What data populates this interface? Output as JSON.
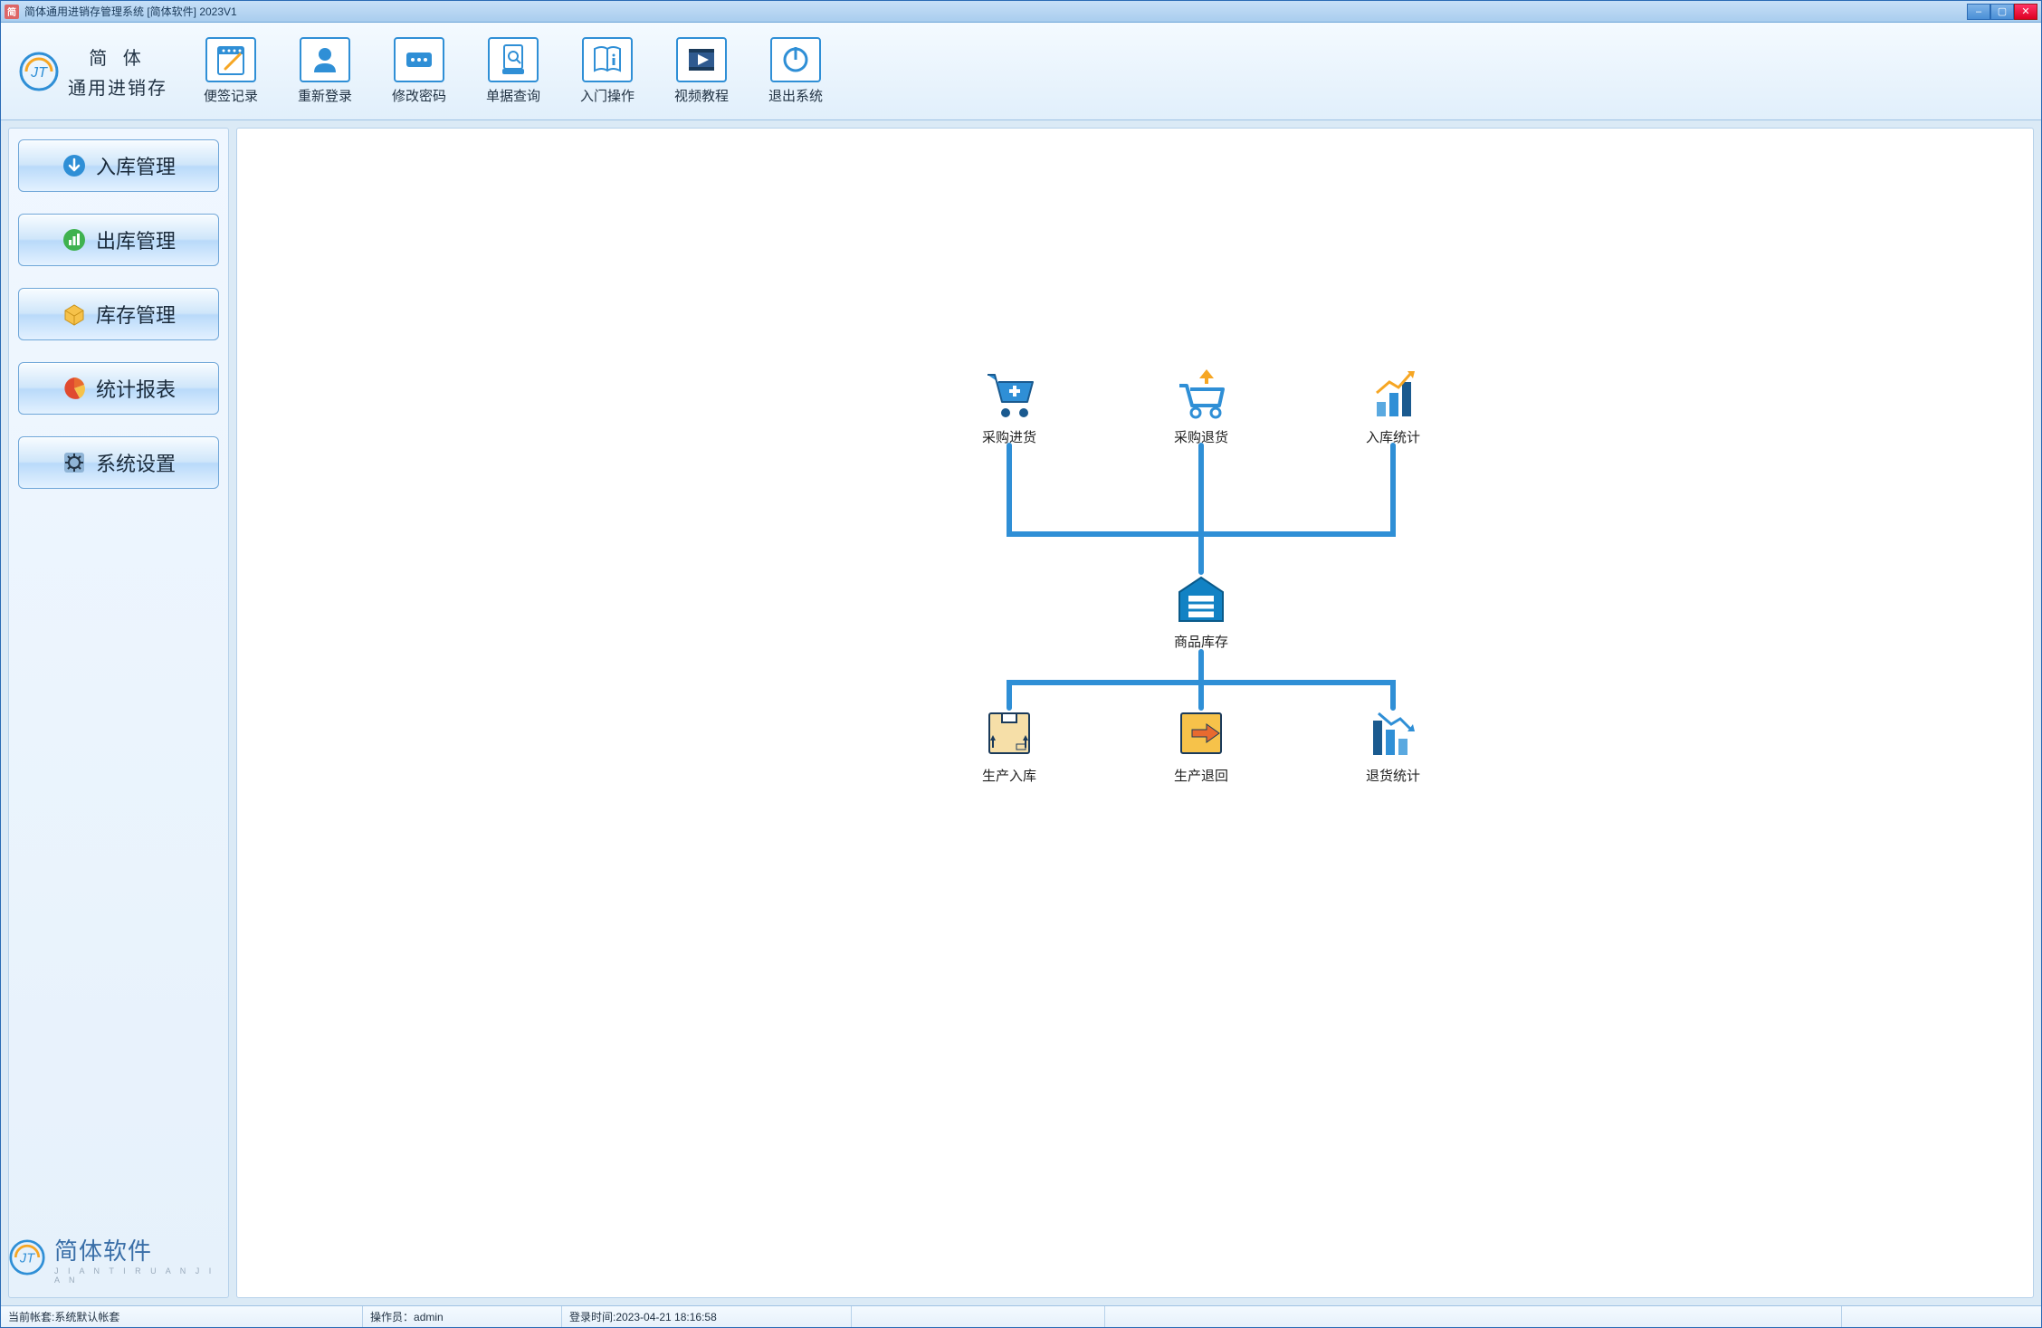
{
  "window": {
    "title": "简体通用进销存管理系统 [简体软件] 2023V1"
  },
  "brand": {
    "line1": "简 体",
    "line2": "通用进销存"
  },
  "toolbar": [
    {
      "id": "notes",
      "label": "便签记录"
    },
    {
      "id": "relogin",
      "label": "重新登录"
    },
    {
      "id": "password",
      "label": "修改密码"
    },
    {
      "id": "billquery",
      "label": "单据查询"
    },
    {
      "id": "guide",
      "label": "入门操作"
    },
    {
      "id": "video",
      "label": "视频教程"
    },
    {
      "id": "exit",
      "label": "退出系统"
    }
  ],
  "sidebar": [
    {
      "id": "inbound",
      "label": "入库管理"
    },
    {
      "id": "outbound",
      "label": "出库管理"
    },
    {
      "id": "inventory",
      "label": "库存管理"
    },
    {
      "id": "report",
      "label": "统计报表"
    },
    {
      "id": "settings",
      "label": "系统设置"
    }
  ],
  "footer_brand": {
    "text": "简体软件",
    "pinyin": "J I A N T I R U A N J I A N"
  },
  "flow": {
    "top": [
      {
        "label": "采购进货"
      },
      {
        "label": "采购退货"
      },
      {
        "label": "入库统计"
      }
    ],
    "center": {
      "label": "商品库存"
    },
    "bottom": [
      {
        "label": "生产入库"
      },
      {
        "label": "生产退回"
      },
      {
        "label": "退货统计"
      }
    ]
  },
  "status": {
    "account_label": "当前帐套:",
    "account_value": "系统默认帐套",
    "operator_label": "操作员：",
    "operator_value": "admin",
    "login_label": "登录时间:",
    "login_value": "2023-04-21 18:16:58"
  }
}
